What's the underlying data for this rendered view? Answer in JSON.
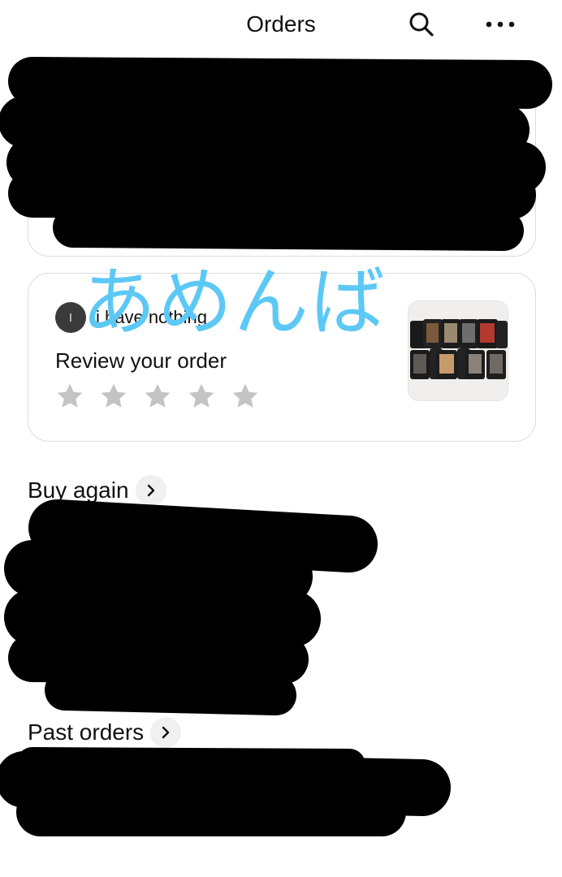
{
  "header": {
    "title": "Orders",
    "search_icon": "search-icon",
    "more_icon": "more-horizontal-icon"
  },
  "review_card": {
    "avatar_initial": "I",
    "shop_name": "i have nothing",
    "review_label": "Review your order",
    "star_count": 5,
    "rating": 0,
    "star_color": "#c4c4c4"
  },
  "overlay": {
    "text": "あめんば",
    "color": "#5cc8f5"
  },
  "sections": {
    "buy_again": "Buy again",
    "past_orders": "Past orders"
  },
  "colors": {
    "redaction": "#000000",
    "card_border": "#dcdcdc"
  }
}
